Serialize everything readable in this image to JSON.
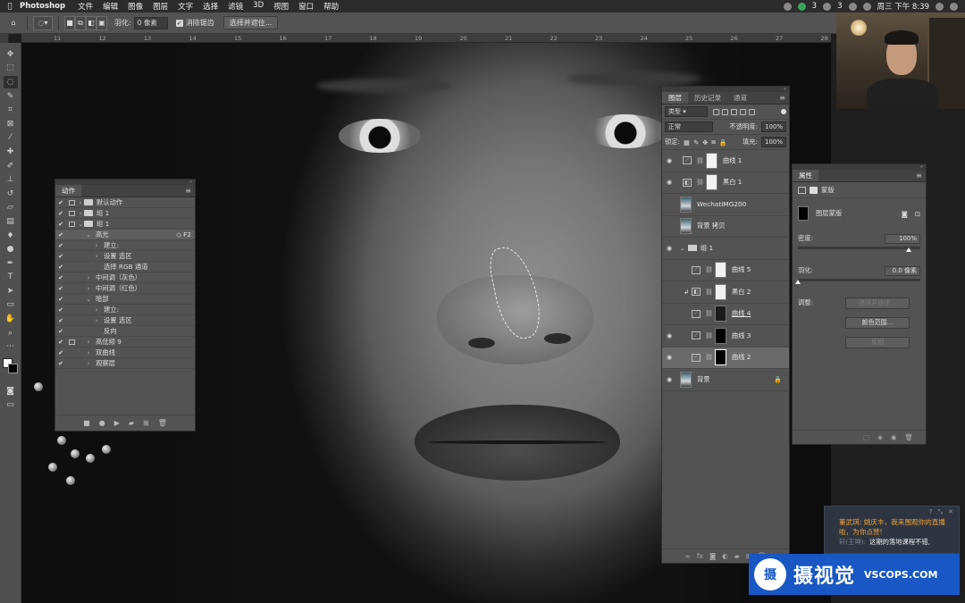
{
  "menubar": {
    "app": "Photoshop",
    "items": [
      "文件",
      "编辑",
      "图像",
      "图层",
      "文字",
      "选择",
      "滤镜",
      "3D",
      "视图",
      "窗口",
      "帮助"
    ],
    "badge1": "3",
    "badge2": "3",
    "clock": "周三 下午 8:39"
  },
  "options": {
    "feather_label": "羽化:",
    "feather_value": "0 像素",
    "antialias_label": "消除锯齿",
    "select_mask_button": "选择并遮住..."
  },
  "ruler": [
    "11",
    "12",
    "13",
    "14",
    "15",
    "16",
    "17",
    "18",
    "19",
    "20",
    "21",
    "22",
    "23",
    "24",
    "25",
    "26",
    "27",
    "28"
  ],
  "actions_panel": {
    "tab": "动作",
    "rows": [
      {
        "label": "默认动作",
        "indent": 0,
        "folder": true,
        "twisty": "›"
      },
      {
        "label": "组 1",
        "indent": 0,
        "folder": true,
        "twisty": "›"
      },
      {
        "label": "组 1",
        "indent": 0,
        "folder": true,
        "twisty": "⌄"
      },
      {
        "label": "高光",
        "indent": 1,
        "folder": false,
        "twisty": "⌄",
        "key": "F2",
        "highlight": true
      },
      {
        "label": "建立:",
        "indent": 2,
        "folder": false,
        "twisty": "›"
      },
      {
        "label": "设置 选区",
        "indent": 2,
        "folder": false,
        "twisty": "›"
      },
      {
        "label": "选择 RGB 通道",
        "indent": 2,
        "folder": false,
        "twisty": ""
      },
      {
        "label": "中间调（灰色）",
        "indent": 1,
        "folder": false,
        "twisty": "›"
      },
      {
        "label": "中间调（红色）",
        "indent": 1,
        "folder": false,
        "twisty": "›"
      },
      {
        "label": "暗部",
        "indent": 1,
        "folder": false,
        "twisty": "⌄"
      },
      {
        "label": "建立:",
        "indent": 2,
        "folder": false,
        "twisty": "›"
      },
      {
        "label": "设置 选区",
        "indent": 2,
        "folder": false,
        "twisty": "›"
      },
      {
        "label": "反向",
        "indent": 2,
        "folder": false,
        "twisty": ""
      },
      {
        "label": "高低频 9",
        "indent": 1,
        "folder": false,
        "twisty": "›",
        "dialog": true
      },
      {
        "label": "双曲线",
        "indent": 1,
        "folder": false,
        "twisty": "›"
      },
      {
        "label": "观察层",
        "indent": 1,
        "folder": false,
        "twisty": "›"
      }
    ]
  },
  "layers_panel": {
    "tabs": [
      "图层",
      "历史记录",
      "通道"
    ],
    "kind": "类型",
    "blend": "正常",
    "opacity_label": "不透明度:",
    "opacity": "100%",
    "lock_label": "锁定:",
    "fill_label": "填充:",
    "fill": "100%",
    "layers": [
      {
        "name": "曲线 1",
        "visible": true,
        "type": "adj",
        "mask": "white",
        "indent": 0
      },
      {
        "name": "黑白 1",
        "visible": true,
        "type": "bw",
        "mask": "white",
        "indent": 0
      },
      {
        "name": "WechatIMG200",
        "visible": false,
        "type": "image",
        "indent": 0
      },
      {
        "name": "背景 拷贝",
        "visible": false,
        "type": "image",
        "indent": 0
      },
      {
        "name": "组 1",
        "visible": true,
        "type": "group",
        "indent": 0
      },
      {
        "name": "曲线 5",
        "visible": false,
        "type": "adj",
        "mask": "white",
        "indent": 1
      },
      {
        "name": "黑白 2",
        "visible": false,
        "type": "bw",
        "mask": "white",
        "indent": 1,
        "clip": true
      },
      {
        "name": "曲线 4",
        "visible": false,
        "type": "adj",
        "mask": "dark",
        "indent": 1,
        "underline": true
      },
      {
        "name": "曲线 3",
        "visible": true,
        "type": "adj",
        "mask": "black",
        "indent": 1
      },
      {
        "name": "曲线 2",
        "visible": true,
        "type": "adj",
        "mask": "black",
        "indent": 1,
        "active": true
      },
      {
        "name": "背景",
        "visible": true,
        "type": "image",
        "indent": 0,
        "locked": true
      }
    ]
  },
  "properties_panel": {
    "tab": "属性",
    "mask_header": "蒙版",
    "layer_mask": "图层蒙版",
    "density_label": "密度:",
    "density": "100%",
    "feather_label": "羽化:",
    "feather": "0.0 像素",
    "adjust_label": "调整:",
    "btn_select_mask": "选择并遮住...",
    "btn_color_range": "颜色范围...",
    "btn_invert": "反相"
  },
  "chat": {
    "line1": "董武琪: 姚庆丰，我来围观你的直播啦，为你点赞!",
    "line2_who": "轩(王坤):",
    "line2": "这期的落地课程不错,"
  },
  "watermark": {
    "logo": "摄",
    "name": "摄视觉",
    "url": "VSCOPS.COM"
  },
  "colors": {
    "panel": "#535353",
    "watermark": "#1857c4"
  }
}
